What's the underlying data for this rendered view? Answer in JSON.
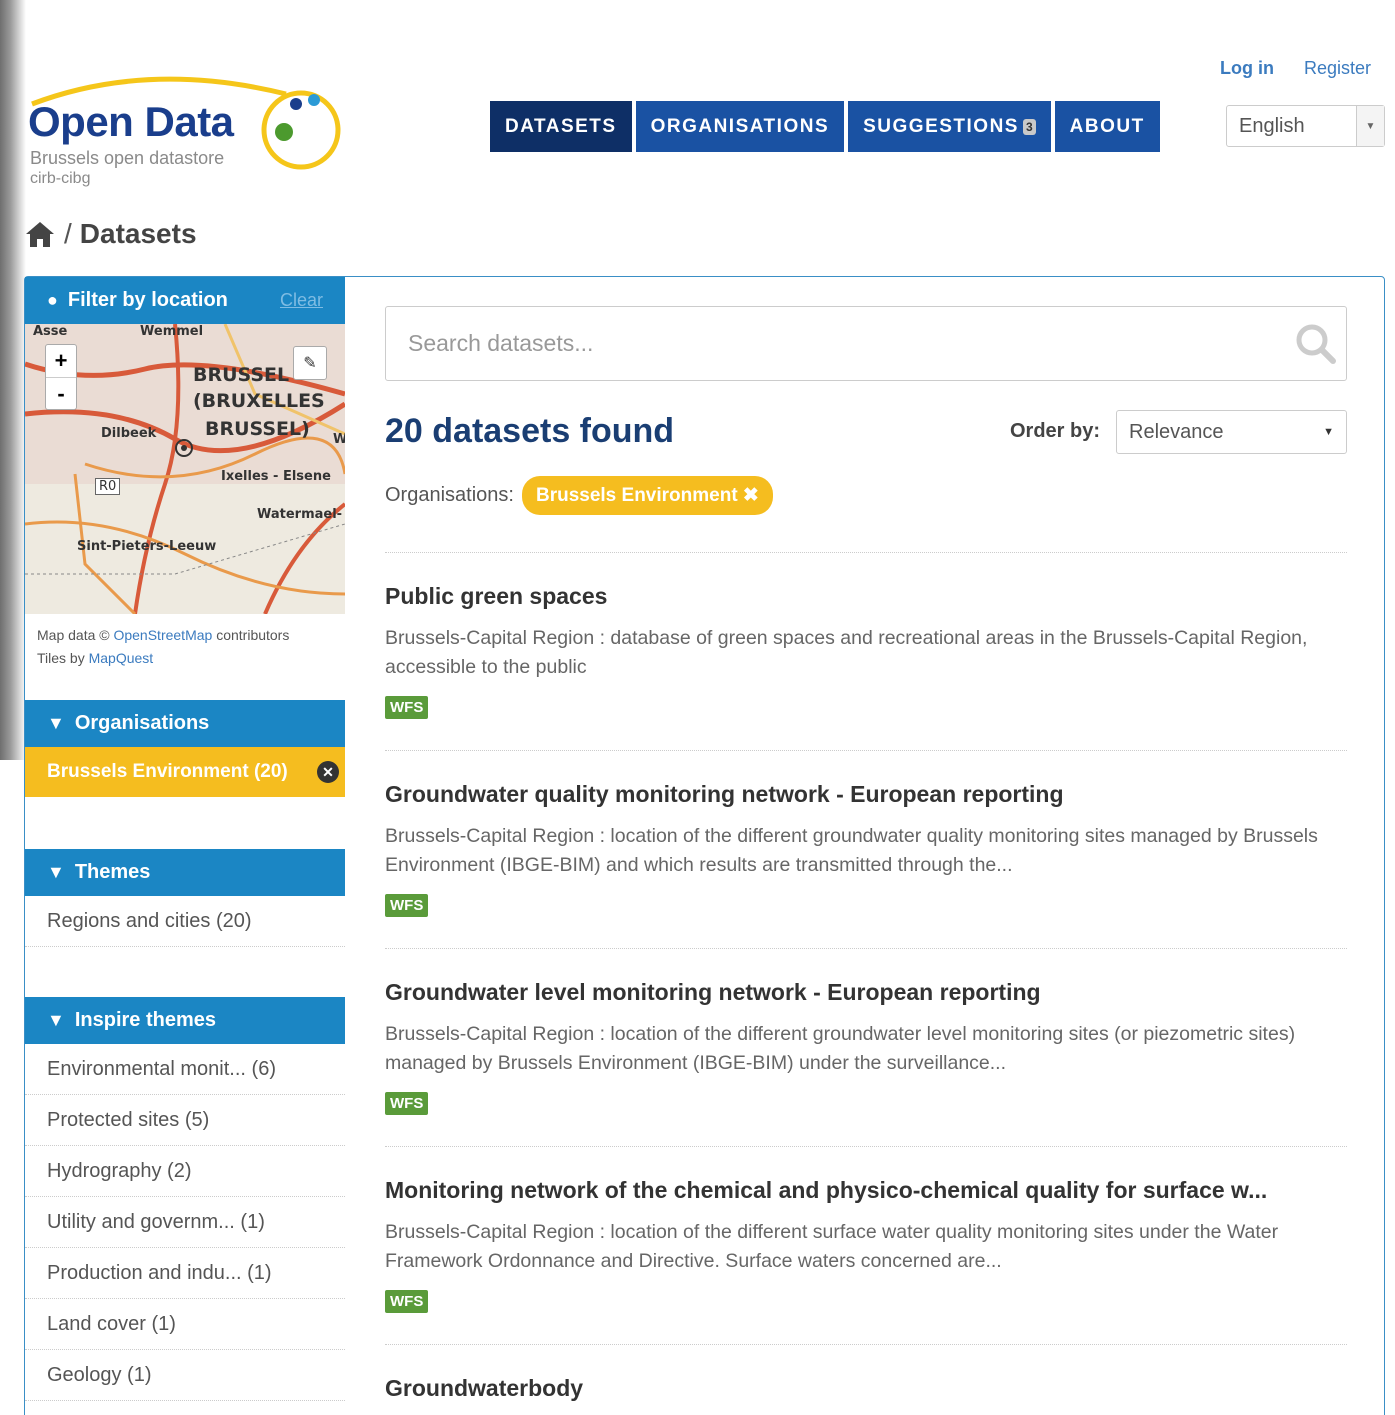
{
  "header": {
    "logo_title": "Open Data",
    "logo_subtitle": "Brussels open datastore",
    "logo_org": "cirb-cibg",
    "login": "Log in",
    "register": "Register",
    "nav": [
      {
        "label": "DATASETS"
      },
      {
        "label": "ORGANISATIONS"
      },
      {
        "label": "SUGGESTIONS"
      },
      {
        "label": "ABOUT"
      }
    ],
    "suggestions_badge": "3",
    "language": "English"
  },
  "breadcrumb": {
    "current": "Datasets"
  },
  "sidebar": {
    "location": {
      "title": "Filter by location",
      "clear": "Clear",
      "zoom_in": "+",
      "zoom_out": "-",
      "labels": [
        "Asse",
        "Wemmel",
        "BRUSSEL",
        "(BRUXELLES",
        "BRUSSEL)",
        "Dilbeek",
        "Ixelles - Elsene",
        "R0",
        "Watermael-",
        "Sint-Pieters-Leeuw",
        "W"
      ],
      "attribution_prefix": "Map data ©",
      "attribution_osm": "OpenStreetMap",
      "attribution_suffix": "contributors",
      "tiles_prefix": "Tiles by",
      "tiles_link": "MapQuest"
    },
    "organisations": {
      "title": "Organisations",
      "active": "Brussels Environment (20)"
    },
    "themes": {
      "title": "Themes",
      "items": [
        "Regions and cities (20)"
      ]
    },
    "inspire": {
      "title": "Inspire themes",
      "items": [
        "Environmental monit... (6)",
        "Protected sites (5)",
        "Hydrography (2)",
        "Utility and governm... (1)",
        "Production and indu... (1)",
        "Land cover (1)",
        "Geology (1)"
      ]
    }
  },
  "search": {
    "placeholder": "Search datasets..."
  },
  "results": {
    "count_text": "20 datasets found",
    "order_label": "Order by:",
    "order_value": "Relevance",
    "facet_label": "Organisations:",
    "facet_pill": "Brussels Environment ✖",
    "items": [
      {
        "title": "Public green spaces",
        "desc": "Brussels-Capital Region : database of green spaces and recreational areas in the Brussels-Capital Region, accessible to the public",
        "format": "WFS"
      },
      {
        "title": "Groundwater quality monitoring network - European reporting",
        "desc": "Brussels-Capital Region : location of the different groundwater quality monitoring sites managed by Brussels Environment (IBGE-BIM) and which results are transmitted through the...",
        "format": "WFS"
      },
      {
        "title": "Groundwater level monitoring network - European reporting",
        "desc": "Brussels-Capital Region : location of the different groundwater level monitoring sites (or piezometric sites) managed by Brussels Environment (IBGE-BIM) under the surveillance...",
        "format": "WFS"
      },
      {
        "title": "Monitoring network of the chemical and physico-chemical quality for surface w...",
        "desc": "Brussels-Capital Region : location of the different surface water quality monitoring sites under the Water Framework Ordonnance and Directive. Surface waters concerned are...",
        "format": "WFS"
      },
      {
        "title": "Groundwaterbody"
      }
    ]
  },
  "colors": {
    "brand_dark": "#1a3e8c",
    "nav_blue": "#1a52a3",
    "nav_active": "#0e2f66",
    "sidebar_blue": "#1b86c4",
    "accent_yellow": "#f5bd1f",
    "format_green": "#5a9b3a"
  }
}
